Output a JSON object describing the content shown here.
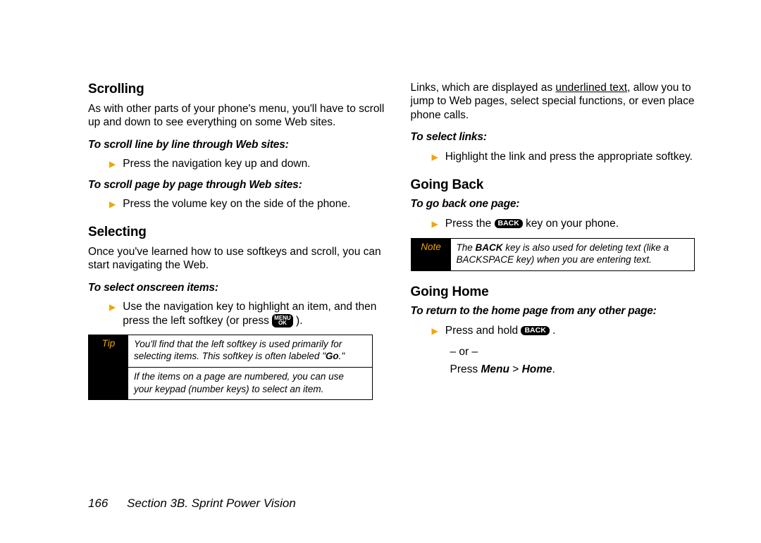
{
  "left": {
    "h1": "Scrolling",
    "p1": "As with other parts of your phone's menu, you'll have to scroll up and down to see everything on some Web sites.",
    "sub1": "To scroll line by line through Web sites:",
    "b1": "Press the navigation key up and down.",
    "sub2": "To scroll page by page through Web sites:",
    "b2": "Press the volume key on the side of the phone.",
    "h2": "Selecting",
    "p2": "Once you've learned how to use softkeys and scroll, you can start navigating the Web.",
    "sub3": "To select onscreen items:",
    "b3a": "Use the navigation key to highlight an item, and then press the left softkey (or press ",
    "b3b": " ).",
    "tip_label": "Tip",
    "tip1a": "You'll find that the left softkey is used primarily for selecting items. This softkey is often labeled \"",
    "tip1b": "Go",
    "tip1c": ".\"",
    "tip2": "If the items on a page are numbered, you can use your keypad (number keys) to select an item."
  },
  "right": {
    "p1a": "Links, which are displayed as ",
    "p1u": "underlined text",
    "p1b": ", allow you to jump to Web pages, select special functions, or even place phone calls.",
    "sub1": "To select links:",
    "b1": "Highlight the link and press the appropriate softkey.",
    "h1": "Going Back",
    "sub2": "To go back one page:",
    "b2a": "Press the ",
    "b2b": " key on your phone.",
    "note_label": "Note",
    "note1a": "The ",
    "note1b": "BACK",
    "note1c": " key is also used for deleting text (like a BACKSPACE key) when you are entering text.",
    "h2": "Going Home",
    "sub3": "To return to the home page from any other page:",
    "b3a": "Press and hold ",
    "b3b": ".",
    "or": "– or –",
    "mp": "Press ",
    "mp_b1": "Menu",
    "mp_gt": " > ",
    "mp_b2": "Home",
    "mp_end": "."
  },
  "keys": {
    "menu": "MENU",
    "ok": "OK",
    "back": "BACK"
  },
  "footer": {
    "page": "166",
    "section": "Section 3B. Sprint Power Vision"
  }
}
